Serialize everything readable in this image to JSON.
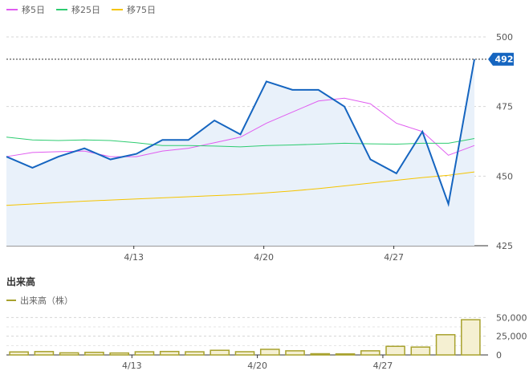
{
  "legend": {
    "items": [
      {
        "label": "移5日",
        "color": "#e05cf0"
      },
      {
        "label": "移25日",
        "color": "#2ecc71"
      },
      {
        "label": "移75日",
        "color": "#f5c400"
      }
    ]
  },
  "volume_panel": {
    "title": "出来高",
    "legend_label": "出来高（株）",
    "legend_color": "#a8a22e"
  },
  "last_price_badge": "492",
  "colors": {
    "price": "#1565c0",
    "area": "#e9f1fa",
    "volume_fill": "#f5f0d2",
    "volume_stroke": "#a8a22e"
  },
  "chart_data": [
    {
      "type": "line",
      "title": "",
      "x_ticks": [
        "4/13",
        "4/20",
        "4/27"
      ],
      "ylim": [
        425,
        500
      ],
      "y_ticks": [
        425,
        450,
        475,
        500
      ],
      "grid": true,
      "x": [
        "4/7",
        "4/8",
        "4/9",
        "4/10",
        "4/11",
        "4/12",
        "4/13",
        "4/14",
        "4/15",
        "4/16",
        "4/17",
        "4/18",
        "4/19",
        "4/20",
        "4/21",
        "4/22",
        "4/23",
        "4/24",
        "4/25",
        "4/26",
        "4/27",
        "4/28",
        "4/29",
        "4/30",
        "5/1"
      ],
      "series": [
        {
          "name": "price",
          "values": [
            457,
            453,
            457,
            460,
            456,
            458,
            463,
            463,
            470,
            465,
            484,
            481,
            481,
            475,
            456,
            451,
            466,
            440,
            492
          ]
        },
        {
          "name": "移5日",
          "values": [
            457,
            458.5,
            458.8,
            459,
            457,
            457,
            459,
            460,
            462,
            464,
            469,
            473,
            477,
            478,
            476,
            469,
            466,
            457.5,
            461
          ]
        },
        {
          "name": "移25日",
          "values": [
            464,
            463,
            462.8,
            463,
            462.8,
            462,
            461,
            461,
            460.8,
            460.5,
            461,
            461.2,
            461.5,
            461.8,
            461.6,
            461.5,
            461.8,
            461.8,
            463.5
          ]
        },
        {
          "name": "移75日",
          "values": [
            439.5,
            440,
            440.5,
            441,
            441.4,
            441.8,
            442.2,
            442.6,
            443,
            443.4,
            444,
            444.7,
            445.5,
            446.5,
            447.5,
            448.5,
            449.5,
            450.3,
            451.5
          ]
        }
      ],
      "last_value": 492
    },
    {
      "type": "bar",
      "title": "出来高",
      "x_ticks": [
        "4/13",
        "4/20",
        "4/27"
      ],
      "ylim": [
        0,
        60000
      ],
      "y_ticks": [
        "0",
        "25,000",
        "50,000"
      ],
      "values": [
        4000,
        4500,
        2800,
        3500,
        2600,
        4200,
        4600,
        4200,
        6200,
        4300,
        7500,
        5500,
        1600,
        1400,
        5500,
        11500,
        10500,
        27000,
        47000
      ]
    }
  ]
}
